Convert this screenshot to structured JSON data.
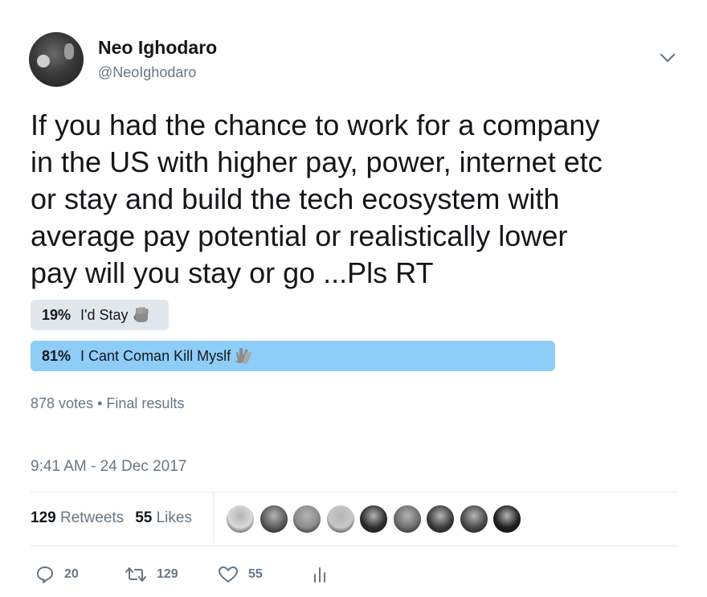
{
  "user": {
    "name": "Neo Ighodaro",
    "handle": "@NeoIghodaro",
    "avatar_icon": "profile-photo"
  },
  "tweet": {
    "text": "If you had the chance to work for a company\nin the US with higher pay, power, internet etc\nor stay and build the tech ecosystem with\naverage pay potential or realistically lower\npay will you stay or go ...Pls RT"
  },
  "poll": {
    "options": [
      {
        "percent_label": "19%",
        "label": "I'd Stay",
        "emoji_icon": "raised-fist-icon",
        "fraction": 0.19,
        "winner": false
      },
      {
        "percent_label": "81%",
        "label": "I Cant Coman Kill Myslf",
        "emoji_icon": "clapping-hands-icon",
        "fraction": 0.81,
        "winner": true
      }
    ],
    "votes": "878 votes",
    "bullet": "•",
    "status": "Final results",
    "colors": {
      "winner": "#8ecdf8",
      "other": "#e1e8ed"
    }
  },
  "timestamp": "9:41 AM - 24 Dec 2017",
  "stats": {
    "retweets_count": "129",
    "retweets_label": "Retweets",
    "likes_count": "55",
    "likes_label": "Likes"
  },
  "likers": [
    {
      "icon": "liker-avatar-1",
      "color": "#d9d9d9"
    },
    {
      "icon": "liker-avatar-2",
      "color": "#5a5a5a"
    },
    {
      "icon": "liker-avatar-3",
      "color": "#8a8a8a"
    },
    {
      "icon": "liker-avatar-4",
      "color": "#c8c8c8"
    },
    {
      "icon": "liker-avatar-5",
      "color": "#2e2e2e"
    },
    {
      "icon": "liker-avatar-6",
      "color": "#6e6e6e"
    },
    {
      "icon": "liker-avatar-7",
      "color": "#3c3c3c"
    },
    {
      "icon": "liker-avatar-8",
      "color": "#4a4a4a"
    },
    {
      "icon": "liker-avatar-9",
      "color": "#1f1f1f"
    }
  ],
  "actions": {
    "reply_count": "20",
    "retweet_count": "129",
    "like_count": "55"
  }
}
